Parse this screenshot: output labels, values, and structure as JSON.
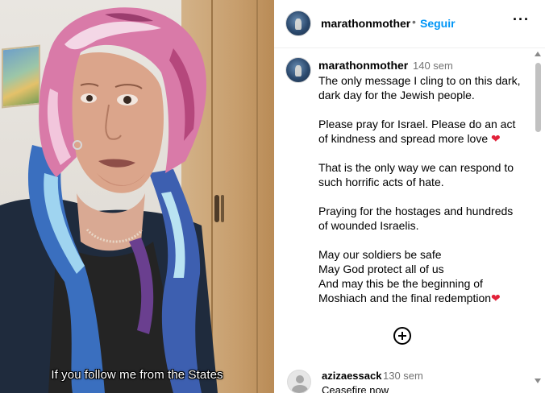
{
  "video": {
    "subtitle": "If you follow me from the States"
  },
  "header": {
    "username": "marathonmother",
    "separator": "•",
    "follow_label": "Seguir",
    "more_label": "···"
  },
  "post": {
    "username": "marathonmother",
    "time": "140 sem",
    "caption_lines": [
      "The only message I cling to on this dark,",
      "dark day for the Jewish people.",
      "",
      "Please pray for Israel. Please do an act",
      "of kindness and spread more love",
      "",
      "That is the only way we can respond to",
      "such horrific acts of hate.",
      "",
      "Praying for the hostages and hundreds",
      "of wounded Israelis.",
      "",
      "May our soldiers be safe",
      "May God protect all of us",
      "And may this be the beginning of",
      "Moshiach and the final redemption"
    ],
    "heart_glyph": "❤"
  },
  "comment": {
    "username": "azizaessack",
    "time": "130 sem",
    "text": "Ceasefire now"
  },
  "colors": {
    "accent": "#0095f6",
    "secondary_text": "#737373",
    "heart": "#e2223a"
  }
}
